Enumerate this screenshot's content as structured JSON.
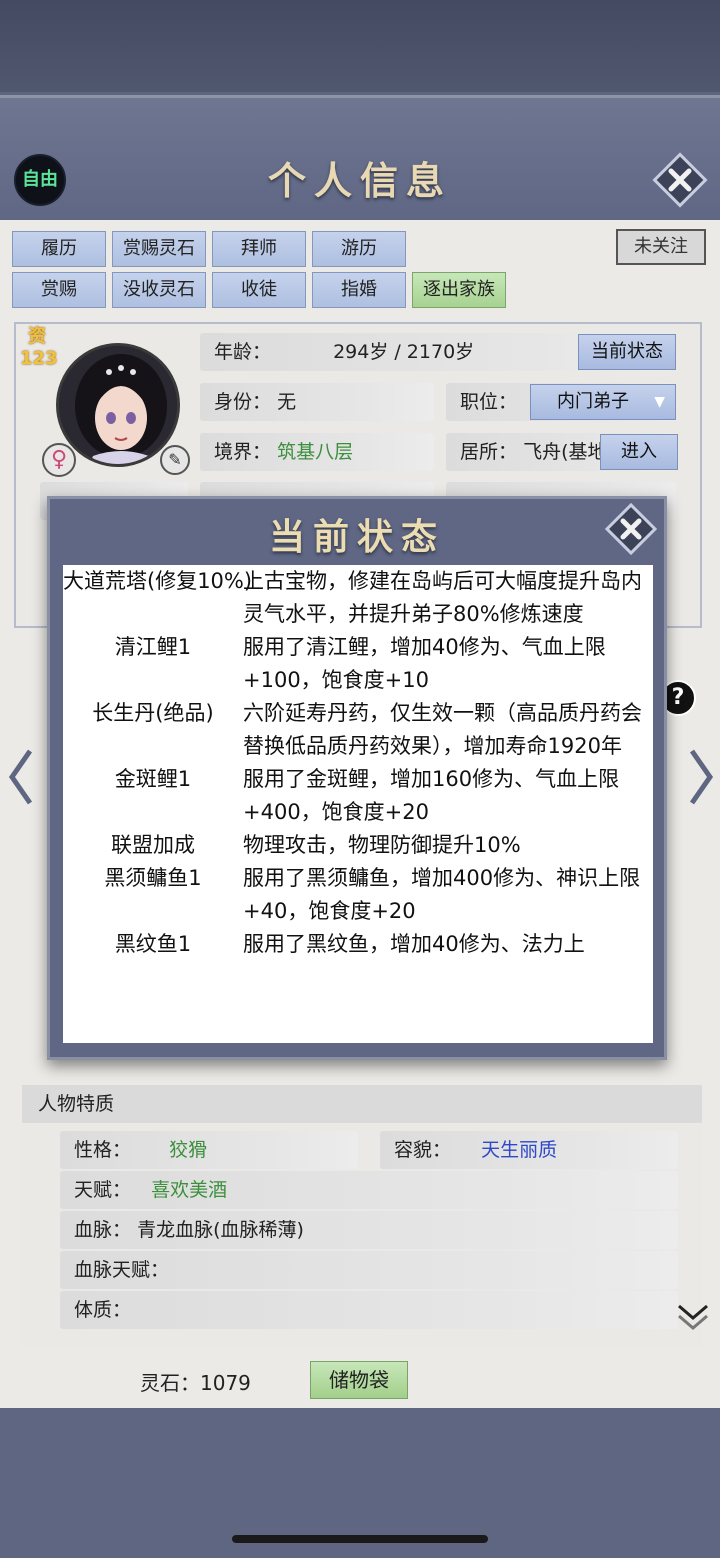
{
  "header": {
    "title": "个人信息",
    "free_label": "自由"
  },
  "tabs_row1": [
    "履历",
    "赏赐灵石",
    "拜师",
    "游历"
  ],
  "tabs_row2": [
    "赏赐",
    "没收灵石",
    "收徒",
    "指婚",
    "逐出家族"
  ],
  "follow_label": "未关注",
  "profile": {
    "talent_label": "资",
    "talent_value": "123",
    "age_label": "年龄：",
    "age_value": "294岁 / 2170岁",
    "status_button": "当前状态",
    "identity_label": "身份：",
    "identity_value": "无",
    "position_label": "职位：",
    "position_value": "内门弟子",
    "realm_label": "境界：",
    "realm_value": "筑基八层",
    "residence_label": "居所：",
    "residence_value": "飞舟(基地",
    "enter_button": "进入"
  },
  "status_dialog": {
    "title": "当前状态",
    "items": [
      {
        "name": "大道荒塔(修复10%)",
        "desc": "上古宝物，修建在岛屿后可大幅度提升岛内灵气水平，并提升弟子80%修炼速度"
      },
      {
        "name": "清江鲤1",
        "desc": "服用了清江鲤，增加40修为、气血上限+100，饱食度+10"
      },
      {
        "name": "长生丹(绝品)",
        "desc": "六阶延寿丹药，仅生效一颗（高品质丹药会替换低品质丹药效果），增加寿命1920年"
      },
      {
        "name": "金斑鲤1",
        "desc": "服用了金斑鲤，增加160修为、气血上限+400，饱食度+20"
      },
      {
        "name": "联盟加成",
        "desc": "物理攻击，物理防御提升10%"
      },
      {
        "name": "黑须鳙鱼1",
        "desc": "服用了黑须鳙鱼，增加400修为、神识上限+40，饱食度+20"
      },
      {
        "name": "黑纹鱼1",
        "desc": "服用了黑纹鱼，增加40修为、法力上"
      }
    ]
  },
  "traits": {
    "section_title": "人物特质",
    "personality_label": "性格：",
    "personality_value": "狡猾",
    "appearance_label": "容貌：",
    "appearance_value": "天生丽质",
    "talent_label": "天赋：",
    "talent_value": "喜欢美酒",
    "bloodline_label": "血脉：",
    "bloodline_value": "青龙血脉(血脉稀薄)",
    "bloodline_talent_label": "血脉天赋：",
    "physique_label": "体质："
  },
  "footer": {
    "stones_label": "灵石：",
    "stones_value": "1079",
    "bag_button": "储物袋"
  },
  "colors": {
    "frame": "#5e6682",
    "panel": "#eceae6",
    "green": "#3c8f3c",
    "blue": "#2d48c9",
    "title_gold": "#e8d9b4"
  },
  "icons": [
    "close-icon",
    "female-icon",
    "brush-icon",
    "help-icon",
    "left-arrow-icon",
    "right-arrow-icon",
    "chevron-down-icon",
    "dropdown-icon"
  ]
}
